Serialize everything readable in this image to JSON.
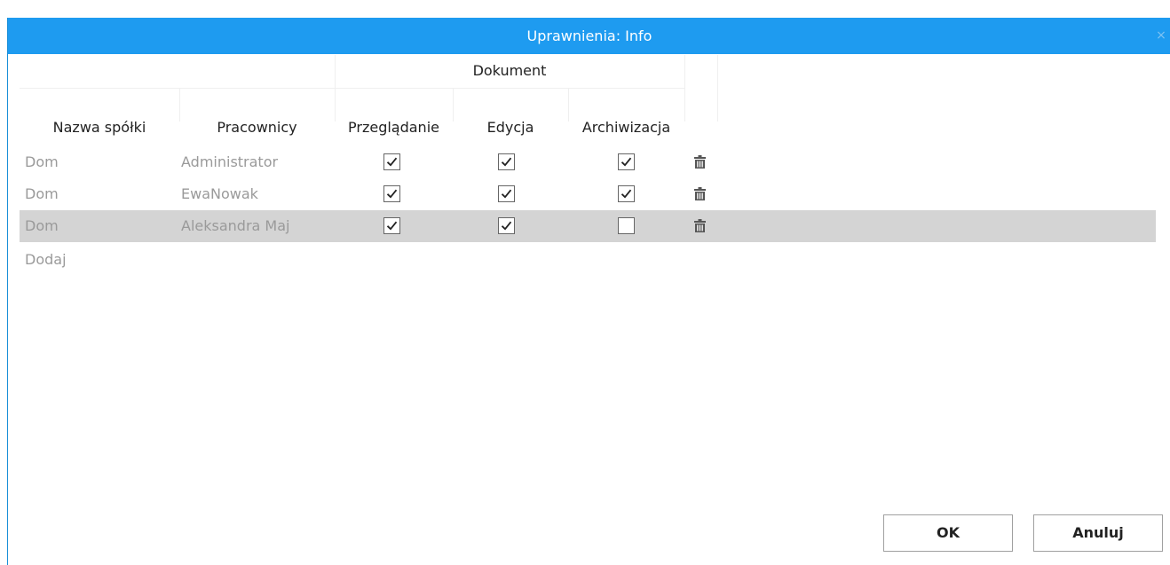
{
  "dialog": {
    "title": "Uprawnienia: Info",
    "close_glyph": "×"
  },
  "table": {
    "group_header": "Dokument",
    "columns": {
      "company": "Nazwa spółki",
      "employees": "Pracownicy",
      "view": "Przeglądanie",
      "edit": "Edycja",
      "archive": "Archiwizacja"
    },
    "rows": [
      {
        "company": "Dom",
        "employee": "Administrator",
        "view": true,
        "edit": true,
        "archive": true,
        "selected": false
      },
      {
        "company": "Dom",
        "employee": "EwaNowak",
        "view": true,
        "edit": true,
        "archive": true,
        "selected": false
      },
      {
        "company": "Dom",
        "employee": "Aleksandra Maj",
        "view": true,
        "edit": true,
        "archive": false,
        "selected": true
      }
    ],
    "add_label": "Dodaj"
  },
  "buttons": {
    "ok": "OK",
    "cancel": "Anuluj"
  },
  "colors": {
    "titlebar": "#1e9bf0",
    "selected_row": "#d4d4d4",
    "muted_text": "#9a9a9a"
  },
  "icons": {
    "delete": "trash-icon",
    "checked": "checkmark-icon",
    "close": "close-icon"
  }
}
